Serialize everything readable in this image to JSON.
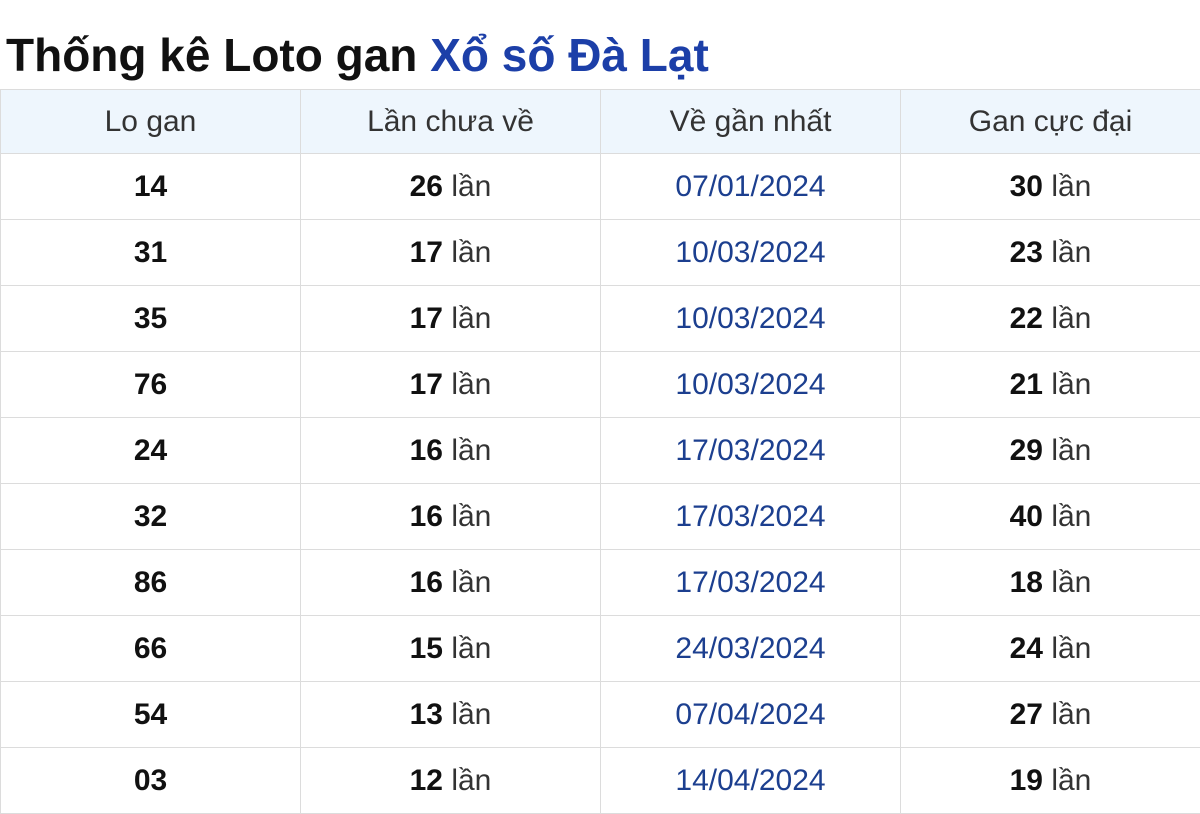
{
  "title": {
    "prefix": "Thống kê Loto gan",
    "accent": "Xổ số Đà Lạt"
  },
  "colors": {
    "accent": "#1c3fa8",
    "date_text": "#1c3f8f",
    "header_bg": "#eef6fd",
    "border": "#dcdcdc"
  },
  "table": {
    "headers": [
      "Lo gan",
      "Lần chưa về",
      "Về gần nhất",
      "Gan cực đại"
    ],
    "unit": "lần",
    "rows": [
      {
        "lo": "14",
        "chua_ve": "26",
        "gan_nhat": "07/01/2024",
        "cuc_dai": "30"
      },
      {
        "lo": "31",
        "chua_ve": "17",
        "gan_nhat": "10/03/2024",
        "cuc_dai": "23"
      },
      {
        "lo": "35",
        "chua_ve": "17",
        "gan_nhat": "10/03/2024",
        "cuc_dai": "22"
      },
      {
        "lo": "76",
        "chua_ve": "17",
        "gan_nhat": "10/03/2024",
        "cuc_dai": "21"
      },
      {
        "lo": "24",
        "chua_ve": "16",
        "gan_nhat": "17/03/2024",
        "cuc_dai": "29"
      },
      {
        "lo": "32",
        "chua_ve": "16",
        "gan_nhat": "17/03/2024",
        "cuc_dai": "40"
      },
      {
        "lo": "86",
        "chua_ve": "16",
        "gan_nhat": "17/03/2024",
        "cuc_dai": "18"
      },
      {
        "lo": "66",
        "chua_ve": "15",
        "gan_nhat": "24/03/2024",
        "cuc_dai": "24"
      },
      {
        "lo": "54",
        "chua_ve": "13",
        "gan_nhat": "07/04/2024",
        "cuc_dai": "27"
      },
      {
        "lo": "03",
        "chua_ve": "12",
        "gan_nhat": "14/04/2024",
        "cuc_dai": "19"
      }
    ]
  }
}
